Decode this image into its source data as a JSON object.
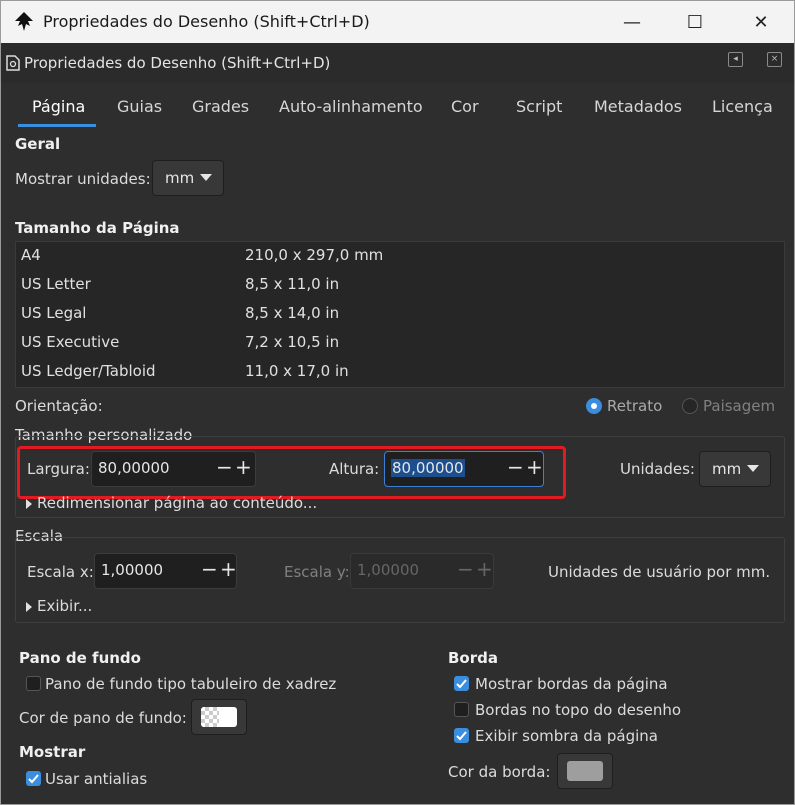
{
  "window": {
    "title": "Propriedades do Desenho (Shift+Ctrl+D)",
    "minimize": "—",
    "maximize": "☐",
    "close": "✕"
  },
  "panel": {
    "title": "Propriedades do Desenho (Shift+Ctrl+D)"
  },
  "tabs": [
    "Página",
    "Guias",
    "Grades",
    "Auto-alinhamento",
    "Cor",
    "Script",
    "Metadados",
    "Licença"
  ],
  "geral": {
    "heading": "Geral",
    "units_label": "Mostrar unidades:",
    "units_value": "mm"
  },
  "page_size": {
    "heading": "Tamanho da Página",
    "rows": [
      {
        "name": "A4",
        "size": "210,0 x 297,0 mm"
      },
      {
        "name": "US Letter",
        "size": "8,5 x 11,0 in"
      },
      {
        "name": "US Legal",
        "size": "8,5 x 14,0 in"
      },
      {
        "name": "US Executive",
        "size": "7,2 x 10,5 in"
      },
      {
        "name": "US Ledger/Tabloid",
        "size": "11,0 x 17,0 in"
      }
    ]
  },
  "orientation": {
    "label": "Orientação:",
    "portrait": "Retrato",
    "landscape": "Paisagem"
  },
  "custom_size": {
    "heading": "Tamanho personalizado",
    "width_label": "Largura:",
    "width_value": "80,00000",
    "height_label": "Altura:",
    "height_value": "80,00000",
    "units_label": "Unidades:",
    "units_value": "mm",
    "resize_label": "Redimensionar página ao conteúdo..."
  },
  "scale": {
    "heading": "Escala",
    "x_label": "Escala x:",
    "x_value": "1,00000",
    "y_label": "Escala y:",
    "y_value": "1,00000",
    "info": "Unidades de usuário por mm.",
    "show_label": "Exibir..."
  },
  "background": {
    "heading": "Pano de fundo",
    "checkerboard_label": "Pano de fundo tipo tabuleiro de xadrez",
    "color_label": "Cor de pano de fundo:"
  },
  "show": {
    "heading": "Mostrar",
    "antialias_label": "Usar antialias"
  },
  "border": {
    "heading": "Borda",
    "show_borders": "Mostrar bordas da página",
    "borders_on_top": "Bordas no topo do desenho",
    "show_shadow": "Exibir sombra da página",
    "color_label": "Cor da borda:"
  },
  "spin": {
    "minus": "−",
    "plus": "+"
  },
  "colors": {
    "accent": "#3b8dde",
    "highlight": "#e21b22",
    "border_swatch": "#9e9e9e"
  }
}
